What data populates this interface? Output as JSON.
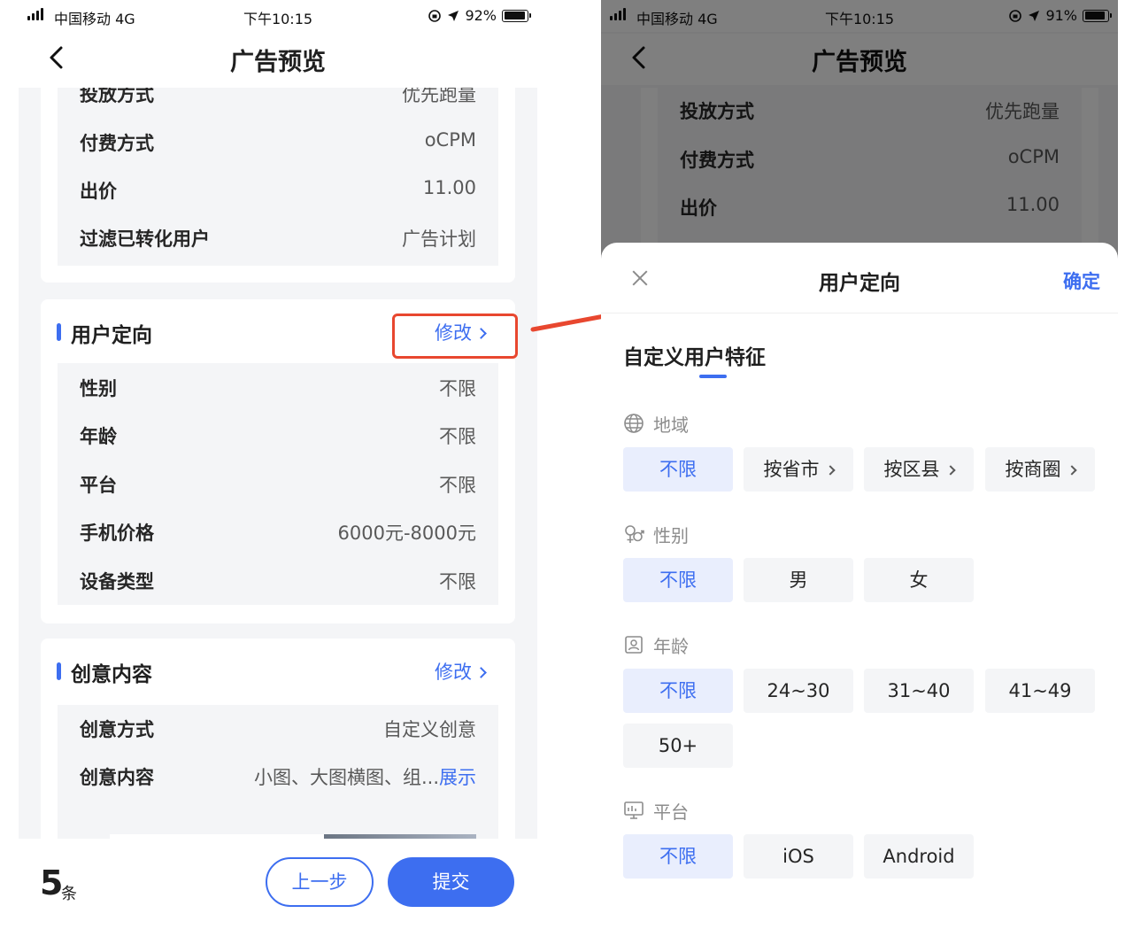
{
  "status_left": {
    "carrier": "中国移动",
    "network": "4G",
    "time": "下午10:15",
    "battery": "92%",
    "battery_level": 0.92
  },
  "status_right": {
    "carrier": "中国移动",
    "network": "4G",
    "time": "下午10:15",
    "battery": "91%",
    "battery_level": 0.91
  },
  "nav_title": "广告预览",
  "placement": {
    "rows": [
      {
        "key": "投放方式",
        "value": "优先跑量"
      },
      {
        "key": "付费方式",
        "value": "oCPM"
      },
      {
        "key": "出价",
        "value": "11.00"
      },
      {
        "key": "过滤已转化用户",
        "value": "广告计划"
      }
    ]
  },
  "targeting": {
    "title": "用户定向",
    "edit": "修改",
    "rows": [
      {
        "key": "性别",
        "value": "不限"
      },
      {
        "key": "年龄",
        "value": "不限"
      },
      {
        "key": "平台",
        "value": "不限"
      },
      {
        "key": "手机价格",
        "value": "6000元-8000元"
      },
      {
        "key": "设备类型",
        "value": "不限"
      }
    ]
  },
  "creative": {
    "title": "创意内容",
    "edit": "修改",
    "rows": [
      {
        "key": "创意方式",
        "value": "自定义创意"
      },
      {
        "key": "创意内容",
        "value": "小图、大图横图、组...",
        "link": "展示"
      }
    ]
  },
  "footer": {
    "count": "5",
    "unit": "条",
    "prev": "上一步",
    "submit": "提交"
  },
  "sheet": {
    "title": "用户定向",
    "confirm": "确定",
    "tab": "自定义用户特征",
    "groups": [
      {
        "label": "地域",
        "icon": "globe-icon",
        "options": [
          "不限",
          "按省市",
          "按区县",
          "按商圈"
        ],
        "selected": 0
      },
      {
        "label": "性别",
        "icon": "gender-icon",
        "options": [
          "不限",
          "男",
          "女"
        ],
        "selected": 0
      },
      {
        "label": "年龄",
        "icon": "age-icon",
        "options": [
          "不限",
          "24~30",
          "31~40",
          "41~49",
          "50+"
        ],
        "selected": 0
      },
      {
        "label": "平台",
        "icon": "monitor-icon",
        "options": [
          "不限",
          "iOS",
          "Android"
        ],
        "selected": 0
      }
    ]
  },
  "colors": {
    "accent": "#3d6ef0",
    "highlight": "#e8472f",
    "selected_bg": "#e9eefd",
    "page_bg": "#f4f5f7"
  }
}
